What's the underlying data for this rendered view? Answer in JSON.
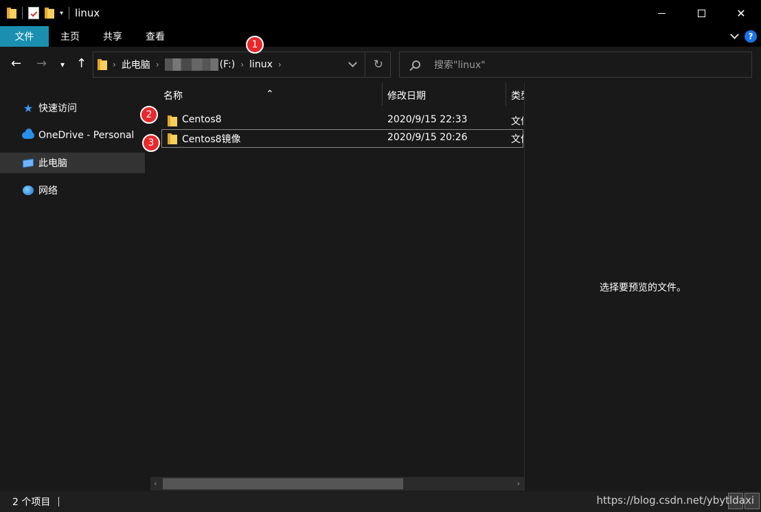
{
  "window": {
    "title": "linux"
  },
  "ribbon": {
    "tabs": [
      "文件",
      "主页",
      "共享",
      "查看"
    ]
  },
  "address": {
    "breadcrumbs": [
      "此电脑",
      "(F:)",
      "linux"
    ]
  },
  "search": {
    "placeholder": "搜索\"linux\""
  },
  "nav": {
    "items": [
      {
        "label": "快速访问",
        "icon": "star-icon"
      },
      {
        "label": "OneDrive - Personal",
        "icon": "cloud-icon"
      },
      {
        "label": "此电脑",
        "icon": "computer-icon"
      },
      {
        "label": "网络",
        "icon": "network-icon"
      }
    ],
    "selected_index": 2
  },
  "columns": {
    "name": "名称",
    "date": "修改日期",
    "type": "类型"
  },
  "files": [
    {
      "name": "Centos8",
      "date": "2020/9/15 22:33",
      "type": "文件夹"
    },
    {
      "name": "Centos8镜像",
      "date": "2020/9/15 20:26",
      "type": "文件夹"
    }
  ],
  "preview": {
    "message": "选择要预览的文件。"
  },
  "status": {
    "count": "2 个项目"
  },
  "watermark": "https://blog.csdn.net/ybytldaxi",
  "annotations": [
    "1",
    "2",
    "3"
  ],
  "colors": {
    "accent": "#1b8fb0",
    "badge": "#e8282b",
    "background": "#191919"
  }
}
